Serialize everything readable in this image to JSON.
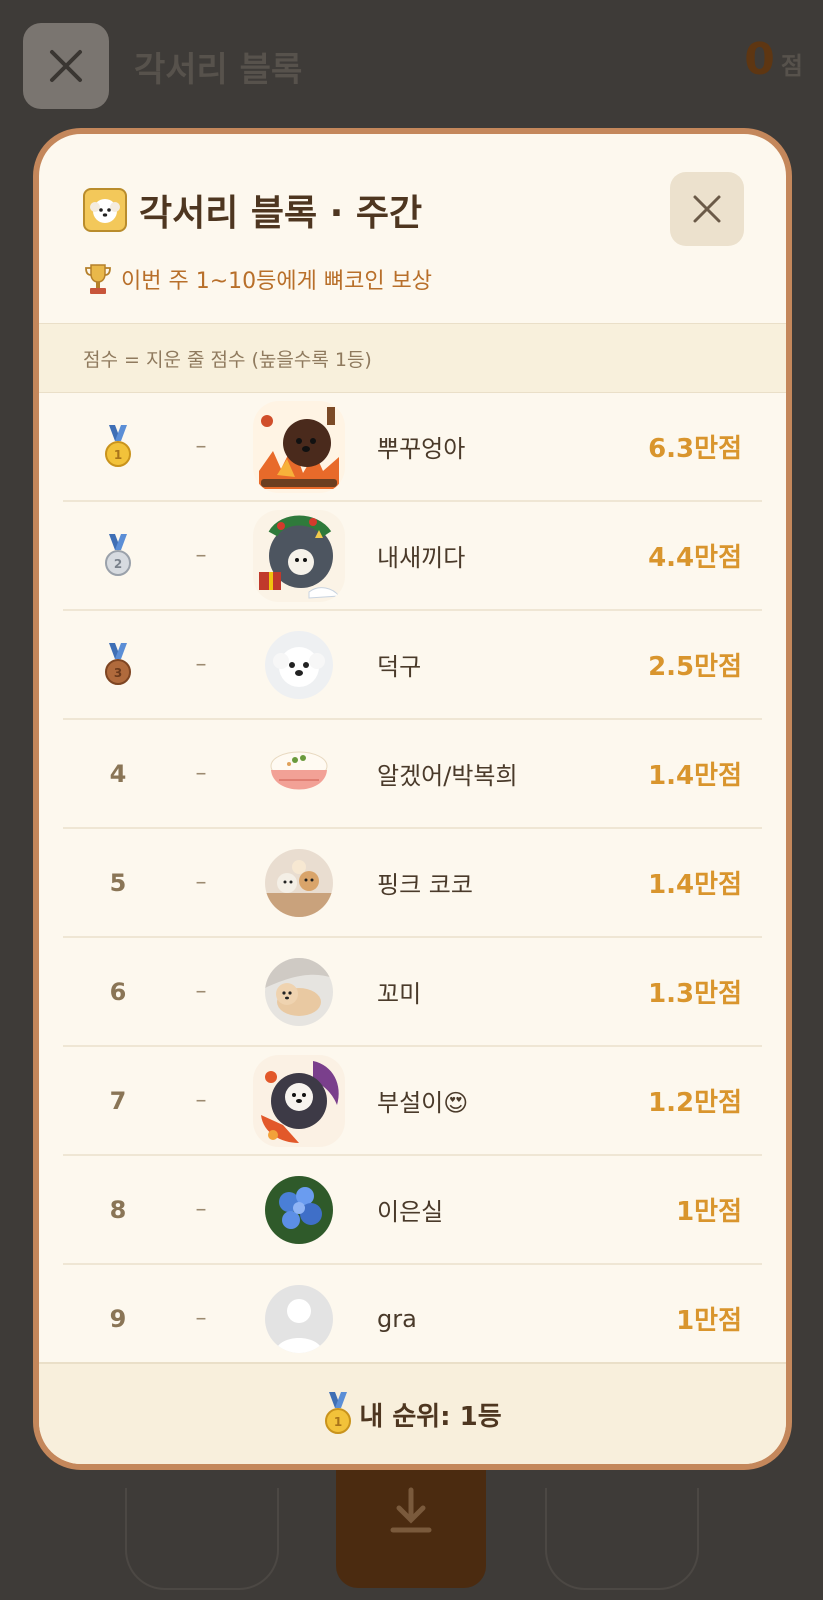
{
  "background": {
    "title": "각서리 블록",
    "score_value": "0",
    "score_unit": "점"
  },
  "modal": {
    "title": "각서리 블록 · 주간",
    "reward_text": "이번 주 1~10등에게 뼈코인 보상",
    "info_text": "점수 = 지운 줄 점수 (높을수록 1등)",
    "rows": [
      {
        "rank": "1",
        "medal": "gold",
        "change": "–",
        "name": "뿌꾸엉아",
        "score": "6.3만점",
        "avatar": "framed-autumn"
      },
      {
        "rank": "2",
        "medal": "silver",
        "change": "–",
        "name": "내새끼다",
        "score": "4.4만점",
        "avatar": "framed-christmas"
      },
      {
        "rank": "3",
        "medal": "bronze",
        "change": "–",
        "name": "덕구",
        "score": "2.5만점",
        "avatar": "white-dog"
      },
      {
        "rank": "4",
        "medal": "",
        "change": "–",
        "name": "알겠어/박복희",
        "score": "1.4만점",
        "avatar": "rice-bowl"
      },
      {
        "rank": "5",
        "medal": "",
        "change": "–",
        "name": "핑크 코코",
        "score": "1.4만점",
        "avatar": "dogs-photo"
      },
      {
        "rank": "6",
        "medal": "",
        "change": "–",
        "name": "꼬미",
        "score": "1.3만점",
        "avatar": "pom-photo"
      },
      {
        "rank": "7",
        "medal": "",
        "change": "–",
        "name": "부설이😍",
        "score": "1.2만점",
        "avatar": "framed-halloween"
      },
      {
        "rank": "8",
        "medal": "",
        "change": "–",
        "name": "이은실",
        "score": "1만점",
        "avatar": "blue-flowers"
      },
      {
        "rank": "9",
        "medal": "",
        "change": "–",
        "name": "gra",
        "score": "1만점",
        "avatar": "default-person"
      }
    ],
    "my_rank_text": "내 순위: 1등"
  },
  "colors": {
    "accent_score": "#d9952d",
    "modal_border": "#c4875b",
    "modal_bg": "#fdf8ee"
  }
}
